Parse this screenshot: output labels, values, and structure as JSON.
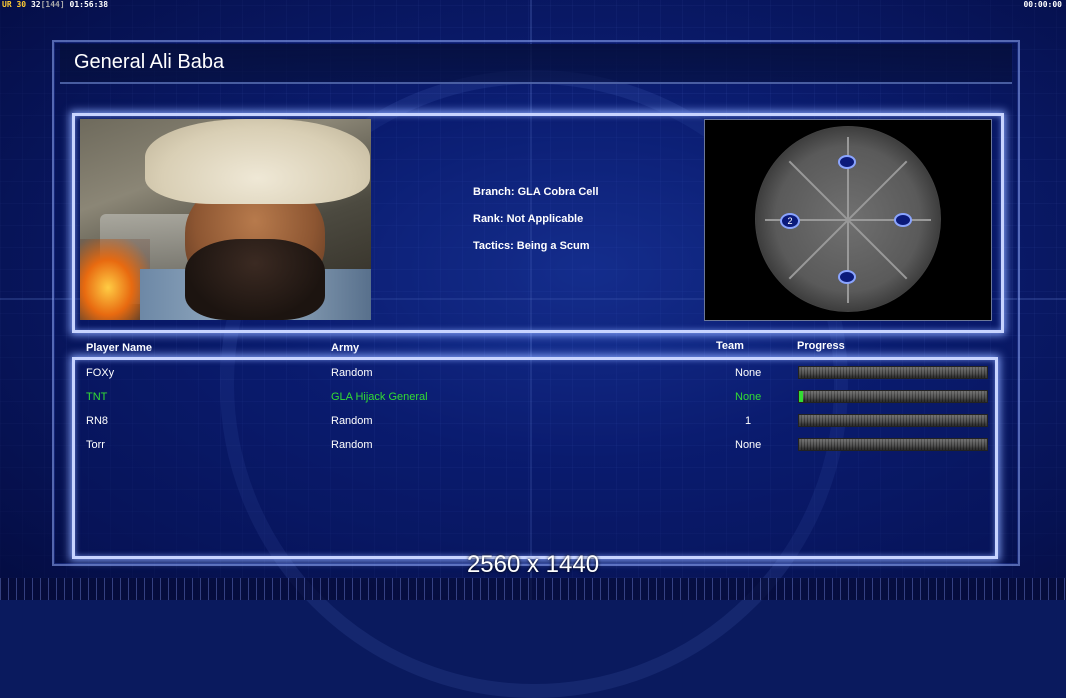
{
  "hud": {
    "left_tag": "UR",
    "left_a": "30",
    "left_b": "32",
    "left_c": "[144]",
    "left_time": "01:56:38",
    "right_time": "00:00:00"
  },
  "general": {
    "name": "General Ali Baba",
    "branch": "Branch: GLA Cobra Cell",
    "rank": "Rank: Not Applicable",
    "tactics": "Tactics: Being a Scum"
  },
  "minimap": {
    "start_label": "2"
  },
  "table": {
    "headers": {
      "player": "Player Name",
      "army": "Army",
      "team": "Team",
      "progress": "Progress"
    },
    "rows": [
      {
        "player": "FOXy",
        "army": "Random",
        "team": "None",
        "progress": 0.0,
        "highlight": false
      },
      {
        "player": "TNT",
        "army": "GLA Hijack General",
        "team": "None",
        "progress": 0.02,
        "highlight": true
      },
      {
        "player": "RN8",
        "army": "Random",
        "team": "1",
        "progress": 0.0,
        "highlight": false
      },
      {
        "player": "Torr",
        "army": "Random",
        "team": "None",
        "progress": 0.0,
        "highlight": false
      }
    ]
  },
  "resolution": "2560 x 1440",
  "colors": {
    "highlight": "#33dd33",
    "panel_border": "#c8d4ff"
  }
}
